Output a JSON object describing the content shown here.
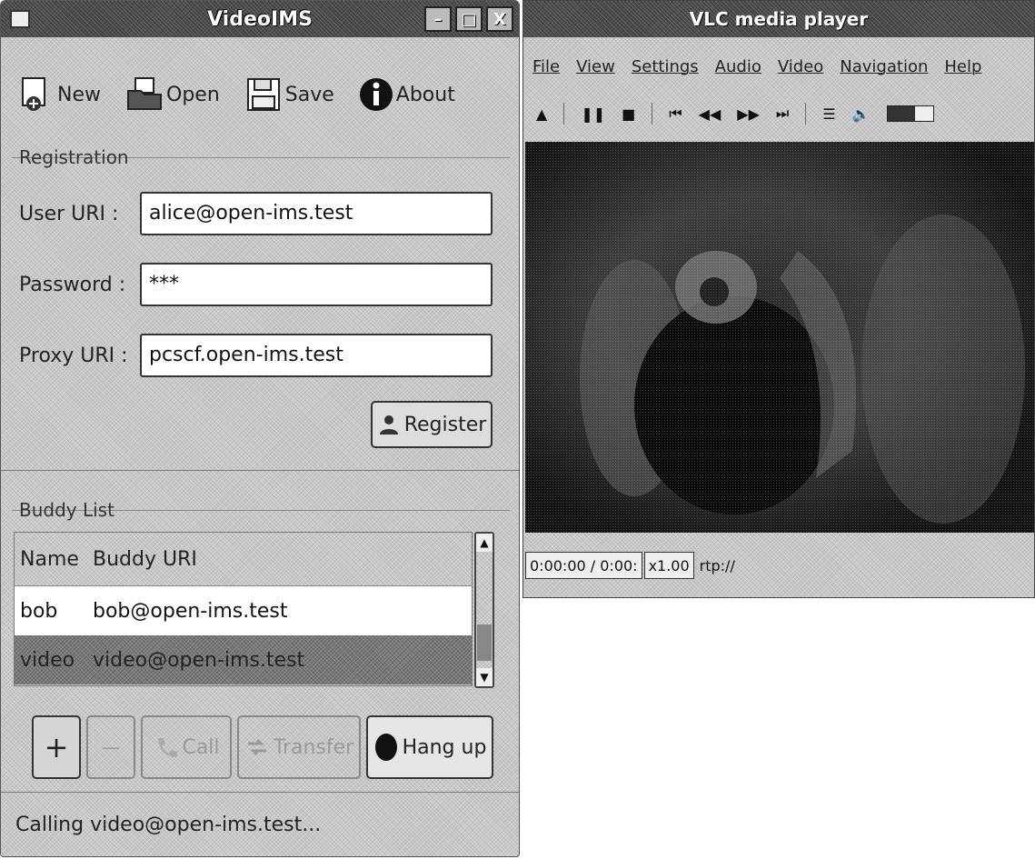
{
  "left_window": {
    "title": "VideoIMS",
    "controls": {
      "minimize": "–",
      "maximize": "□",
      "close": "X"
    },
    "toolbar": [
      {
        "id": "new",
        "label": "New",
        "icon": "new-document-icon"
      },
      {
        "id": "open",
        "label": "Open",
        "icon": "open-folder-icon"
      },
      {
        "id": "save",
        "label": "Save",
        "icon": "floppy-disk-icon"
      },
      {
        "id": "about",
        "label": "About",
        "icon": "info-icon"
      }
    ],
    "registration": {
      "group_label": "Registration",
      "user_uri_label": "User URI :",
      "user_uri_value": "alice@open-ims.test",
      "password_label": "Password :",
      "password_value": "***",
      "proxy_uri_label": "Proxy URI :",
      "proxy_uri_value": "pcscf.open-ims.test",
      "register_label": "Register"
    },
    "buddy_list": {
      "group_label": "Buddy List",
      "columns": [
        "Name",
        "Buddy URI"
      ],
      "rows": [
        {
          "name": "bob",
          "uri": "bob@open-ims.test",
          "selected": false
        },
        {
          "name": "video",
          "uri": "video@open-ims.test",
          "selected": true
        }
      ]
    },
    "actions": {
      "add": "+",
      "remove": "—",
      "call": "Call",
      "transfer": "Transfer",
      "hang_up": "Hang up"
    },
    "status": "Calling video@open-ims.test..."
  },
  "vlc_window": {
    "title": "VLC media player",
    "menu": [
      "File",
      "View",
      "Settings",
      "Audio",
      "Video",
      "Navigation",
      "Help"
    ],
    "controls": [
      "▲",
      "❚❚",
      "■",
      "⏮",
      "◀◀",
      "▶▶",
      "⏭",
      "☰",
      "🔈"
    ],
    "status": {
      "time": "0:00:00 / 0:00:",
      "speed": "x1.00",
      "stream": "rtp://"
    }
  }
}
